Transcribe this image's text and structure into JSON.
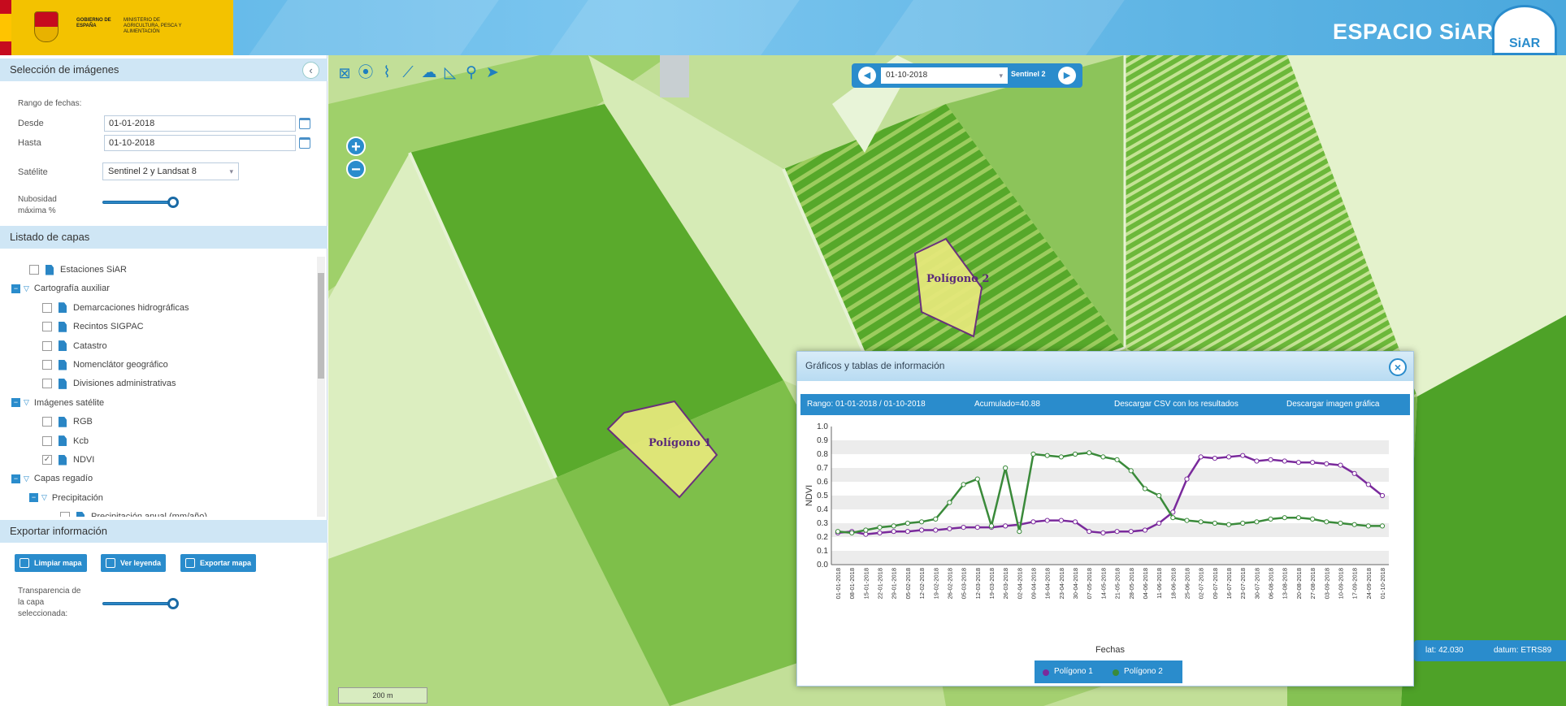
{
  "header": {
    "title": "ESPACIO SiAR",
    "gov_text": "GOBIERNO DE ESPAÑA",
    "ministry_text": "MINISTERIO DE AGRICULTURA, PESCA Y ALIMENTACIÓN",
    "logo_text": "SiAR"
  },
  "left_panel": {
    "selection": {
      "title": "Selección de imágenes",
      "collapse_icon": "chevron-left-icon",
      "date_range_label": "Rango de fechas:",
      "from_label": "Desde",
      "from_value": "01-01-2018",
      "to_label": "Hasta",
      "to_value": "01-10-2018",
      "satellite_label": "Satélite",
      "satellite_value": "Sentinel 2 y Landsat 8",
      "cloud_label_1": "Nubosidad",
      "cloud_label_2": "máxima %",
      "cloud_level_percent": 100
    },
    "layers": {
      "title": "Listado de capas",
      "items": [
        {
          "label": "Estaciones SiAR",
          "checked": false
        },
        {
          "label": "Cartografía auxiliar",
          "group": true
        },
        {
          "label": "Demarcaciones hidrográficas",
          "checked": false
        },
        {
          "label": "Recintos SIGPAC",
          "checked": false
        },
        {
          "label": "Catastro",
          "checked": false
        },
        {
          "label": "Nomenclátor geográfico",
          "checked": false
        },
        {
          "label": "Divisiones administrativas",
          "checked": false
        },
        {
          "label": "Imágenes satélite",
          "group": true
        },
        {
          "label": "RGB",
          "checked": false
        },
        {
          "label": "Kcb",
          "checked": false
        },
        {
          "label": "NDVI",
          "checked": true
        },
        {
          "label": "Capas regadío",
          "group": true
        },
        {
          "label": "Precipitación",
          "group": true
        },
        {
          "label": "Precipitación anual (mm/año)",
          "checked": false
        }
      ]
    },
    "export": {
      "title": "Exportar información",
      "clear_button": "Limpiar mapa",
      "legend_button": "Ver leyenda",
      "export_button": "Exportar mapa",
      "transparency_label_1": "Transparencia de",
      "transparency_label_2": "la capa",
      "transparency_label_3": "seleccionada:",
      "transparency_level_percent": 100
    }
  },
  "map": {
    "tools": [
      "extent-icon",
      "marker-icon",
      "draw-polygon-icon",
      "chart-line-icon",
      "cloud-icon",
      "measure-icon",
      "search-icon",
      "pointer-icon"
    ],
    "zoom_in": "+",
    "zoom_out": "−",
    "date_nav": {
      "date": "01-10-2018",
      "satellite": "Sentinel 2"
    },
    "polygon_1_label": "Polígono 1",
    "polygon_2_label": "Polígono 2",
    "coords": {
      "lat": "lat: 42.030",
      "datum": "datum: ETRS89"
    },
    "scale": "200 m"
  },
  "dialog": {
    "title": "Gráficos y tablas de información",
    "range": "Rango: 01-01-2018 / 01-10-2018",
    "accumulated": "Acumulado=40.88",
    "csv_button": "Descargar CSV con los resultados",
    "image_button": "Descargar imagen gráfica",
    "legend": [
      "Polígono 1",
      "Polígono 2"
    ]
  },
  "colors": {
    "accent": "#2a8ccc",
    "series_1": "#7a2a9c",
    "series_2": "#3a8a3a"
  },
  "chart_data": {
    "type": "line",
    "ylabel": "NDVI",
    "xlabel": "Fechas",
    "ylim": [
      0,
      1
    ],
    "yticks": [
      "0.0",
      "0.1",
      "0.2",
      "0.3",
      "0.4",
      "0.5",
      "0.6",
      "0.7",
      "0.8",
      "0.9",
      "1.0"
    ],
    "x": [
      "01-01-2018",
      "08-01-2018",
      "15-01-2018",
      "22-01-2018",
      "29-01-2018",
      "05-02-2018",
      "12-02-2018",
      "19-02-2018",
      "26-02-2018",
      "05-03-2018",
      "12-03-2018",
      "19-03-2018",
      "26-03-2018",
      "02-04-2018",
      "09-04-2018",
      "16-04-2018",
      "23-04-2018",
      "30-04-2018",
      "07-05-2018",
      "14-05-2018",
      "21-05-2018",
      "28-05-2018",
      "04-06-2018",
      "11-06-2018",
      "18-06-2018",
      "25-06-2018",
      "02-07-2018",
      "09-07-2018",
      "16-07-2018",
      "23-07-2018",
      "30-07-2018",
      "06-08-2018",
      "13-08-2018",
      "20-08-2018",
      "27-08-2018",
      "03-09-2018",
      "10-09-2018",
      "17-09-2018",
      "24-09-2018",
      "01-10-2018"
    ],
    "series": [
      {
        "name": "Polígono 1",
        "values": [
          0.23,
          0.24,
          0.22,
          0.23,
          0.24,
          0.24,
          0.25,
          0.25,
          0.26,
          0.27,
          0.27,
          0.27,
          0.28,
          0.29,
          0.31,
          0.32,
          0.32,
          0.31,
          0.24,
          0.23,
          0.24,
          0.24,
          0.25,
          0.3,
          0.38,
          0.62,
          0.78,
          0.77,
          0.78,
          0.79,
          0.75,
          0.76,
          0.75,
          0.74,
          0.74,
          0.73,
          0.72,
          0.66,
          0.58,
          0.5
        ]
      },
      {
        "name": "Polígono 2",
        "values": [
          0.24,
          0.23,
          0.25,
          0.27,
          0.28,
          0.3,
          0.31,
          0.33,
          0.45,
          0.58,
          0.62,
          0.28,
          0.7,
          0.24,
          0.8,
          0.79,
          0.78,
          0.8,
          0.81,
          0.78,
          0.76,
          0.68,
          0.55,
          0.5,
          0.34,
          0.32,
          0.31,
          0.3,
          0.29,
          0.3,
          0.31,
          0.33,
          0.34,
          0.34,
          0.33,
          0.31,
          0.3,
          0.29,
          0.28,
          0.28
        ]
      }
    ]
  }
}
